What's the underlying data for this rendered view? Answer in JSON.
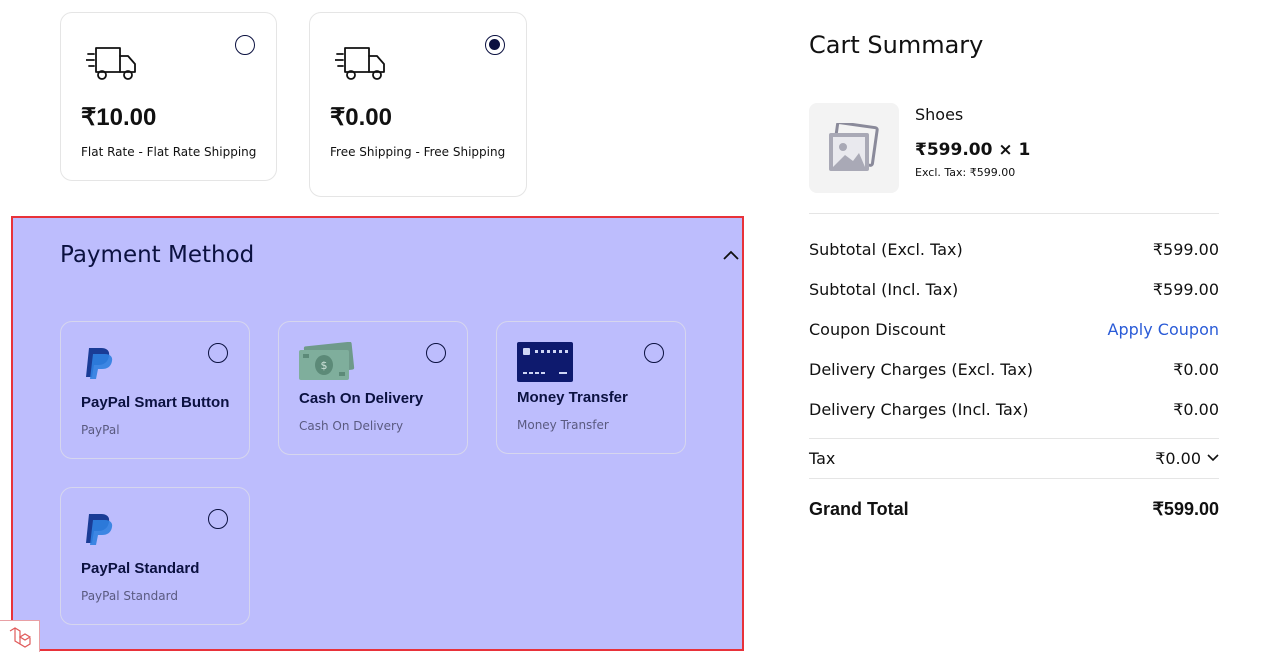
{
  "shipping": {
    "options": [
      {
        "price": "₹10.00",
        "label": "Flat Rate - Flat Rate Shipping",
        "selected": false,
        "icon": "truck-icon"
      },
      {
        "price": "₹0.00",
        "label": "Free Shipping - Free Shipping",
        "selected": true,
        "icon": "truck-icon"
      }
    ]
  },
  "payment": {
    "title": "Payment Method",
    "methods": [
      {
        "name": "PayPal Smart Button",
        "subtitle": "PayPal",
        "icon": "paypal-icon",
        "selected": false
      },
      {
        "name": "Cash On Delivery",
        "subtitle": "Cash On Delivery",
        "icon": "cash-icon",
        "selected": false
      },
      {
        "name": "Money Transfer",
        "subtitle": "Money Transfer",
        "icon": "card-icon",
        "selected": false
      },
      {
        "name": "PayPal Standard",
        "subtitle": "PayPal Standard",
        "icon": "paypal-icon",
        "selected": false
      }
    ],
    "highlight_color": "#bdbdfd",
    "border_color": "#e8323a"
  },
  "cart": {
    "title": "Cart Summary",
    "item": {
      "name": "Shoes",
      "price_qty": "₹599.00 × 1",
      "excl_tax": "Excl. Tax: ₹599.00"
    },
    "rows": {
      "subtotal_excl": {
        "label": "Subtotal (Excl. Tax)",
        "value": "₹599.00"
      },
      "subtotal_incl": {
        "label": "Subtotal (Incl. Tax)",
        "value": "₹599.00"
      },
      "coupon": {
        "label": "Coupon Discount",
        "value": "Apply Coupon"
      },
      "delivery_excl": {
        "label": "Delivery Charges (Excl. Tax)",
        "value": "₹0.00"
      },
      "delivery_incl": {
        "label": "Delivery Charges (Incl. Tax)",
        "value": "₹0.00"
      },
      "tax": {
        "label": "Tax",
        "value": "₹0.00"
      },
      "grand": {
        "label": "Grand Total",
        "value": "₹599.00"
      }
    },
    "link_color": "#2a5bd7"
  }
}
